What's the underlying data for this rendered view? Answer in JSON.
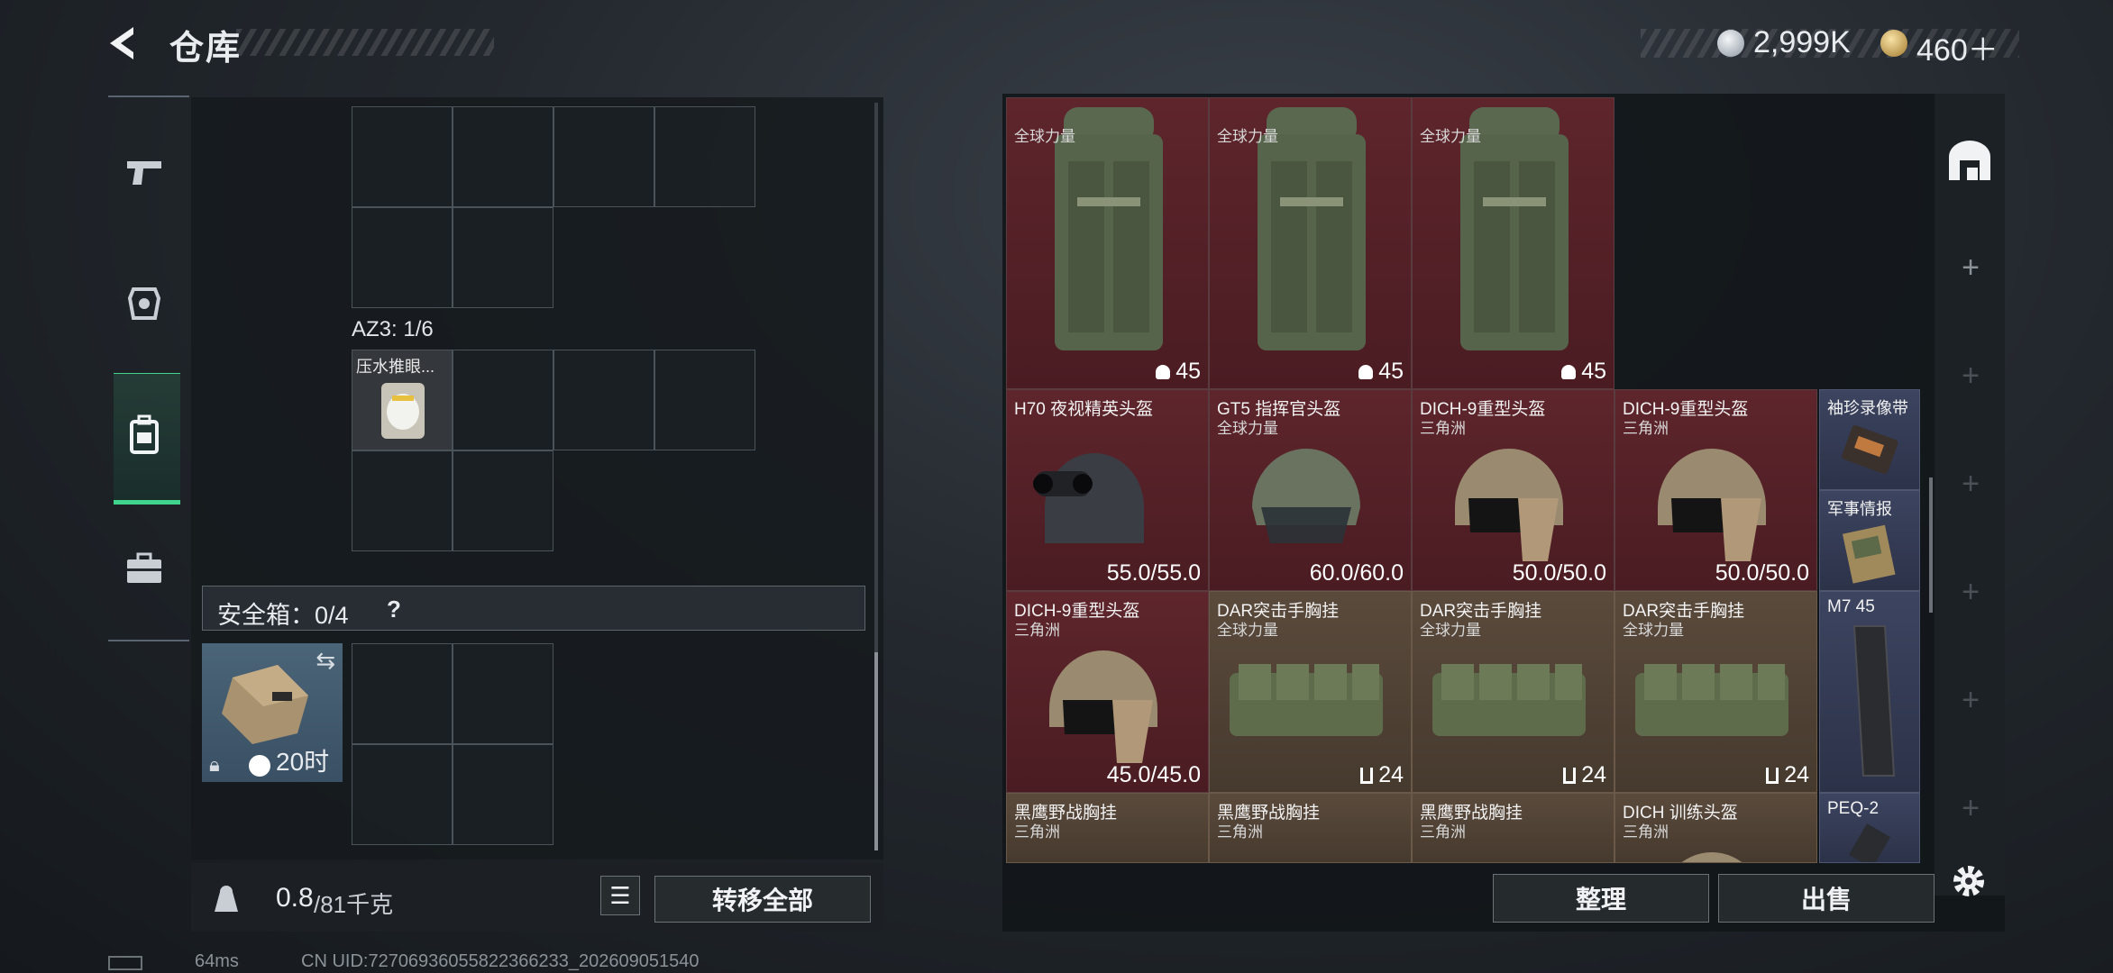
{
  "header": {
    "title": "仓库"
  },
  "currency": {
    "silver": "2,999K",
    "gold": "460＋"
  },
  "left": {
    "az3_label": "AZ3: 1/6",
    "item_name": "压水推眼...",
    "safe_box_label": "安全箱：0/4",
    "help": "?",
    "safe_box_timer": "20时",
    "weight_value": "0.8",
    "weight_limit": "/81千克",
    "transfer_all": "转移全部"
  },
  "grid": [
    {
      "name": "",
      "sub": "全球力量",
      "value": "45",
      "kind": "bag",
      "color": "red"
    },
    {
      "name": "",
      "sub": "全球力量",
      "value": "45",
      "kind": "bag",
      "color": "red"
    },
    {
      "name": "",
      "sub": "全球力量",
      "value": "45",
      "kind": "bag",
      "color": "red"
    },
    {
      "name": "H70 夜视精英头盔",
      "sub": "",
      "value": "55.0/55.0",
      "kind": "helmet-nv",
      "color": "red"
    },
    {
      "name": "GT5 指挥官头盔",
      "sub": "全球力量",
      "value": "60.0/60.0",
      "kind": "helmet-gt5",
      "color": "red"
    },
    {
      "name": "DICH-9重型头盔",
      "sub": "三角洲",
      "value": "50.0/50.0",
      "kind": "helmet-dich",
      "color": "red"
    },
    {
      "name": "DICH-9重型头盔",
      "sub": "三角洲",
      "value": "50.0/50.0",
      "kind": "helmet-dich",
      "color": "red"
    },
    {
      "name": "DICH-9重型头盔",
      "sub": "三角洲",
      "value": "45.0/45.0",
      "kind": "helmet-dich",
      "color": "red"
    },
    {
      "name": "DAR突击手胸挂",
      "sub": "全球力量",
      "value": "24",
      "kind": "vest",
      "color": "brown"
    },
    {
      "name": "DAR突击手胸挂",
      "sub": "全球力量",
      "value": "24",
      "kind": "vest",
      "color": "brown"
    },
    {
      "name": "DAR突击手胸挂",
      "sub": "全球力量",
      "value": "24",
      "kind": "vest",
      "color": "brown"
    },
    {
      "name": "黑鹰野战胸挂",
      "sub": "三角洲",
      "value": "",
      "kind": "vest",
      "color": "brown"
    },
    {
      "name": "黑鹰野战胸挂",
      "sub": "三角洲",
      "value": "",
      "kind": "vest",
      "color": "brown"
    },
    {
      "name": "黑鹰野战胸挂",
      "sub": "三角洲",
      "value": "",
      "kind": "vest",
      "color": "brown"
    },
    {
      "name": "DICH 训练头盔",
      "sub": "三角洲",
      "value": "",
      "kind": "helmet-dich",
      "color": "brown"
    }
  ],
  "small_items": [
    {
      "name": "袖珍录像带"
    },
    {
      "name": "军事情报"
    },
    {
      "name": "M7 45"
    },
    {
      "name": "PEQ-2"
    }
  ],
  "actions": {
    "sort": "整理",
    "sell": "出售"
  },
  "status": {
    "ping": "64ms",
    "uid": "CN UID:72706936055822366233_202609051540"
  },
  "colors": {
    "accent": "#3fd38c",
    "tile_red": "#5e252c",
    "tile_brown": "#5a4a3c",
    "tile_blue": "#3c4460"
  }
}
